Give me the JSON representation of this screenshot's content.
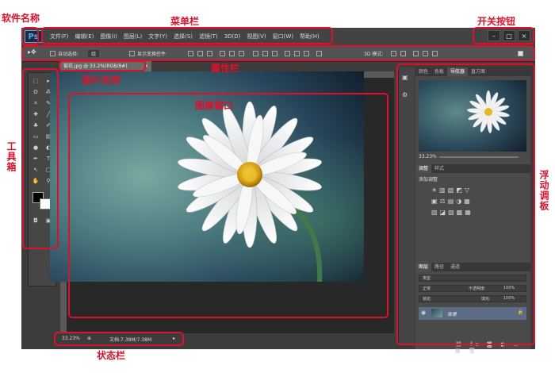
{
  "annotations": {
    "software_name": "软件名称",
    "menu_bar": "菜单栏",
    "switch_buttons": "开关按钮",
    "image_name": "图片名称",
    "attribute_bar": "属性栏",
    "image_window": "图像窗口",
    "toolbox": "工具箱",
    "floating_panel": "浮动调板",
    "status_bar": "状态栏"
  },
  "app": {
    "logo": "Ps",
    "menu": [
      "文件(F)",
      "编辑(E)",
      "图像(I)",
      "图层(L)",
      "文字(Y)",
      "选择(S)",
      "滤镜(T)",
      "3D(D)",
      "视图(V)",
      "窗口(W)",
      "帮助(H)"
    ],
    "window_controls": [
      "–",
      "□",
      "×"
    ]
  },
  "options_bar": {
    "auto_select": "自动选择:",
    "group": "组",
    "show_transform": "显示变换控件",
    "mode_3d": "3D 模式:"
  },
  "document": {
    "tab_label": "菊花.jpg @ 33.2%(RGB/8#)"
  },
  "status": {
    "zoom": "33.23%",
    "doc_size": "文档:7.38M/7.38M"
  },
  "panels": {
    "nav_tabs": [
      "颜色",
      "色板",
      "导航器",
      "直方图"
    ],
    "nav_zoom": "33.23%",
    "adjust_tabs": [
      "调整",
      "样式"
    ],
    "adjust_add": "添加调整",
    "layer_tabs": [
      "图层",
      "路径",
      "通道"
    ],
    "kind": "类型",
    "blend_mode": "正常",
    "opacity_label": "不透明度:",
    "opacity_value": "100%",
    "lock_label": "锁定:",
    "fill_label": "填充:",
    "fill_value": "100%",
    "layer_name": "背景"
  }
}
